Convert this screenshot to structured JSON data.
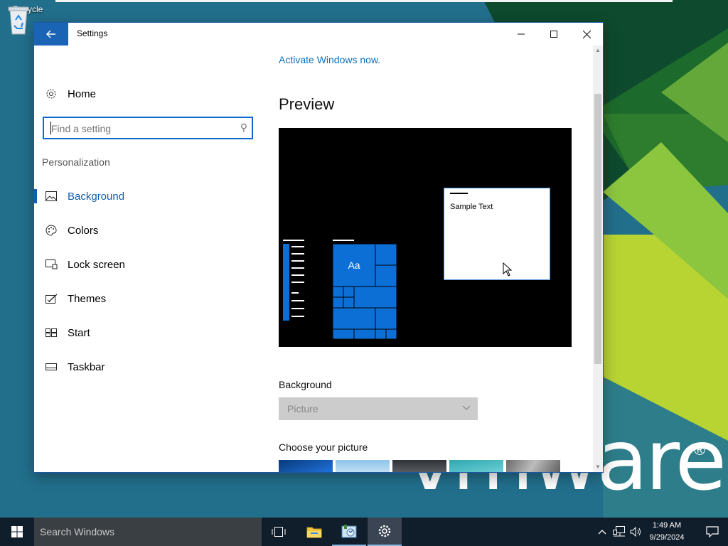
{
  "desktop": {
    "recycle_bin_label": "Recycle",
    "vmware_logo": "vmware",
    "registered_mark": "®"
  },
  "window": {
    "title": "Settings",
    "back_icon": "arrow-left-icon",
    "controls": {
      "minimize": "—",
      "maximize": "☐",
      "close": "✕"
    }
  },
  "sidebar": {
    "home_label": "Home",
    "search_placeholder": "Find a setting",
    "section_title": "Personalization",
    "items": [
      {
        "label": "Background",
        "icon": "picture-icon",
        "active": true
      },
      {
        "label": "Colors",
        "icon": "palette-icon",
        "active": false
      },
      {
        "label": "Lock screen",
        "icon": "lock-screen-icon",
        "active": false
      },
      {
        "label": "Themes",
        "icon": "themes-icon",
        "active": false
      },
      {
        "label": "Start",
        "icon": "start-tiles-icon",
        "active": false
      },
      {
        "label": "Taskbar",
        "icon": "taskbar-icon",
        "active": false
      }
    ]
  },
  "content": {
    "activate_link": "Activate Windows now.",
    "preview_heading": "Preview",
    "preview_tile_label": "Aa",
    "preview_sample_text": "Sample Text",
    "background_label": "Background",
    "background_value": "Picture",
    "choose_picture_label": "Choose your picture"
  },
  "taskbar": {
    "search_text": "Search Windows",
    "time": "1:49 AM",
    "date": "9/29/2024"
  },
  "colors": {
    "accent": "#0f5fb0",
    "tile_blue": "#0c6fd6",
    "taskbar": "#101d2b"
  }
}
